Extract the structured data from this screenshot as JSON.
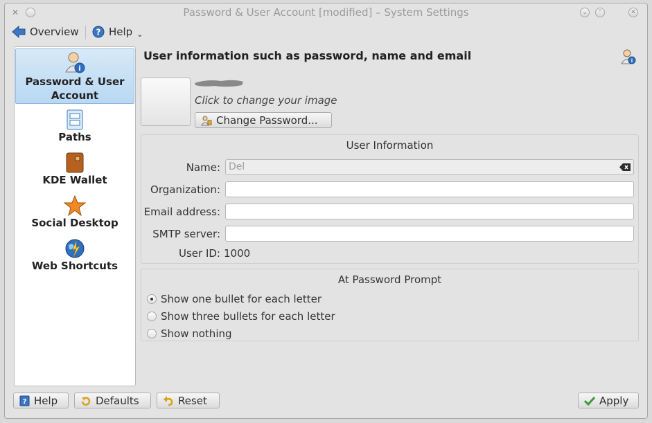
{
  "window": {
    "title": "Password & User Account [modified] – System Settings"
  },
  "toolbar": {
    "overview_label": "Overview",
    "help_label": "Help"
  },
  "sidebar": {
    "items": [
      {
        "label": "Password & User Account",
        "icon": "user-info-icon",
        "selected": true
      },
      {
        "label": "Paths",
        "icon": "paths-icon",
        "selected": false
      },
      {
        "label": "KDE Wallet",
        "icon": "wallet-icon",
        "selected": false
      },
      {
        "label": "Social Desktop",
        "icon": "star-icon",
        "selected": false
      },
      {
        "label": "Web Shortcuts",
        "icon": "globe-icon",
        "selected": false
      }
    ]
  },
  "main": {
    "heading": "User information such as password, name and email",
    "click_to_change": "Click to change your image",
    "change_password_label": "Change Password...",
    "user_info": {
      "title": "User Information",
      "name_label": "Name:",
      "name_value": "Del",
      "organization_label": "Organization:",
      "organization_value": "",
      "email_label": "Email address:",
      "email_value": "",
      "smtp_label": "SMTP server:",
      "smtp_value": "",
      "user_id_label": "User ID:",
      "user_id_value": "1000"
    },
    "password_prompt": {
      "title": "At Password Prompt",
      "options": [
        {
          "label": "Show one bullet for each letter",
          "selected": true
        },
        {
          "label": "Show three bullets for each letter",
          "selected": false
        },
        {
          "label": "Show nothing",
          "selected": false
        }
      ]
    }
  },
  "bottom": {
    "help_label": "Help",
    "defaults_label": "Defaults",
    "reset_label": "Reset",
    "apply_label": "Apply"
  },
  "colors": {
    "selection": "#b9d8f3",
    "window_bg": "#e3e3e3"
  }
}
